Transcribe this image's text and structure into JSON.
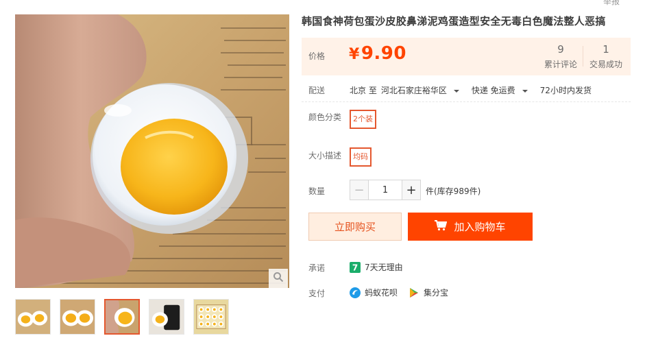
{
  "header": {
    "report": "举报",
    "title": "韩国食神荷包蛋沙皮胶鼻涕泥鸡蛋造型安全无毒白色魔法整人恶搞"
  },
  "price": {
    "label": "价格",
    "currency": "¥",
    "value": "9.90",
    "reviews_count": "9",
    "reviews_label": "累计评论",
    "sales_count": "1",
    "sales_label": "交易成功"
  },
  "shipping": {
    "label": "配送",
    "from": "北京 至",
    "to": "河北石家庄裕华区",
    "method": "快递 免运费",
    "dispatch": "72小时内发货"
  },
  "options": {
    "color_label": "颜色分类",
    "color_value": "2个装",
    "size_label": "大小描述",
    "size_value": "均码"
  },
  "quantity": {
    "label": "数量",
    "minus": "−",
    "plus": "+",
    "value": "1",
    "stock": "件(库存989件)"
  },
  "actions": {
    "buy_now": "立即购买",
    "add_to_cart": "加入购物车"
  },
  "services": {
    "promise_label": "承诺",
    "promise_badge": "7",
    "promise_text": "7天无理由",
    "pay_label": "支付",
    "pay_option_1": "蚂蚁花呗",
    "pay_option_2": "集分宝"
  },
  "colors": {
    "accent": "#ff4400",
    "price": "#ff4400",
    "sku_border": "#e4572e",
    "price_bg": "#fff2e8",
    "promise_green": "#1aad6a",
    "huabei_blue": "#1e9be8"
  },
  "icons": {
    "zoom": "search-icon",
    "cart": "cart-icon",
    "promise": "seven-day-icon",
    "huabei": "huabei-icon",
    "jifenbao": "jifenbao-icon"
  }
}
